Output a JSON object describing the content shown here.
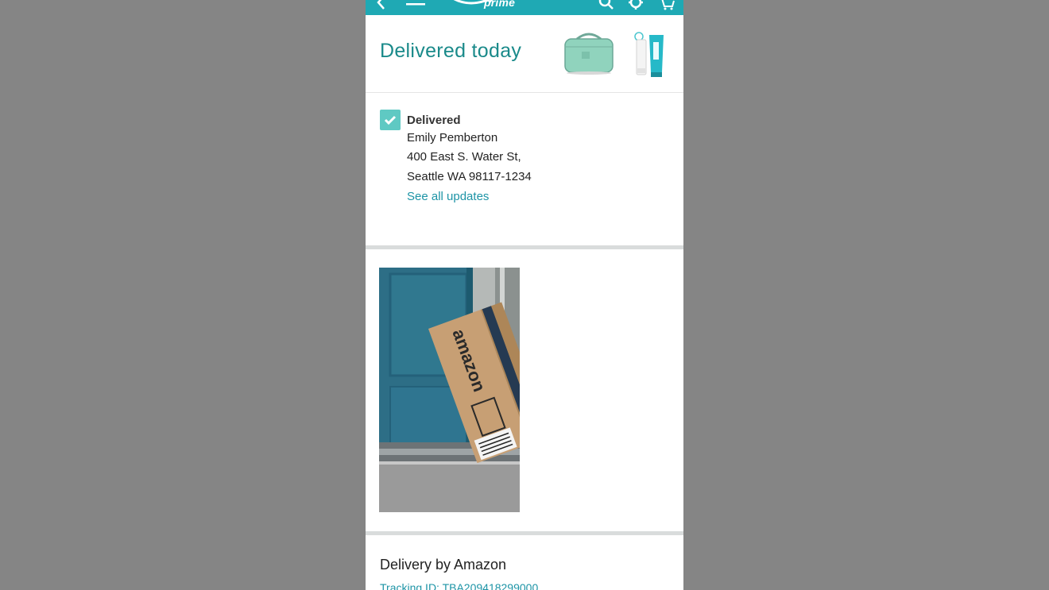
{
  "header": {
    "logo_text": "prime",
    "icons": [
      "back-arrow-icon",
      "menu-icon",
      "search-icon",
      "gear-icon",
      "cart-icon"
    ],
    "bar_color": "#1fa9b4"
  },
  "shipment": {
    "heading": "Delivered today",
    "status": "Delivered",
    "recipient": "Emily Pemberton",
    "address_line1": "400 East S. Water St,",
    "address_line2": "Seattle WA 98117-1234",
    "updates_link": "See all updates"
  },
  "delivery": {
    "heading": "Delivery by Amazon",
    "tracking": "Tracking ID: TBA209418299000",
    "box_brand": "amazon"
  },
  "colors": {
    "accent": "#1a8a8a",
    "link": "#1d94a6",
    "check": "#5fc9c3"
  }
}
